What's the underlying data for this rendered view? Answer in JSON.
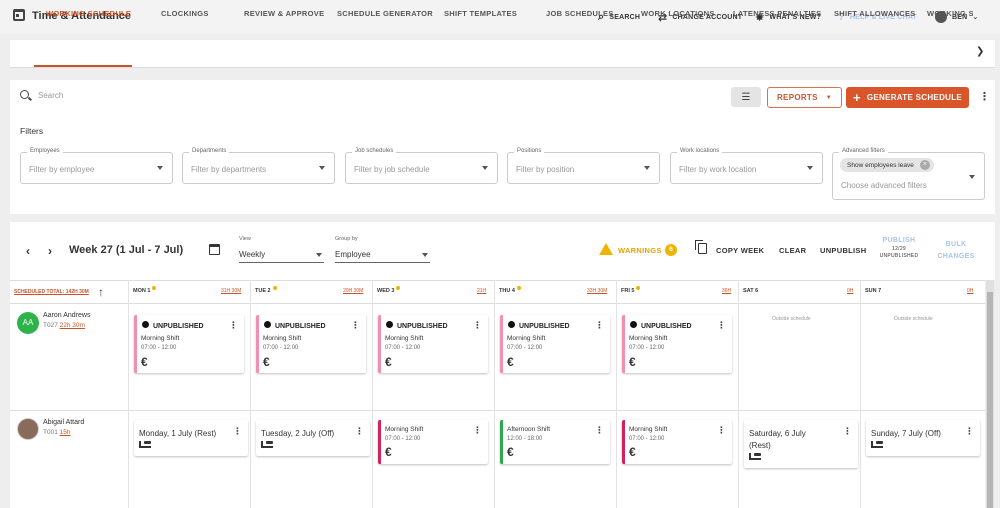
{
  "app": {
    "title": "Time & Attendance"
  },
  "topnav": {
    "search": "SEARCH",
    "change_account": "CHANGE ACCOUNT",
    "whats_new": "WHAT'S NEW?",
    "help": "HELP & LIVE CHAT",
    "user": "BEN"
  },
  "tabs": [
    {
      "label": "WORKING SCHEDULE",
      "active": true
    },
    {
      "label": "CLOCKINGS"
    },
    {
      "label": "REVIEW & APPROVE"
    },
    {
      "label": "SCHEDULE GENERATOR"
    },
    {
      "label": "SHIFT TEMPLATES"
    },
    {
      "label": "JOB SCHEDULES"
    },
    {
      "label": "WORK LOCATIONS"
    },
    {
      "label": "LATENESS PENALTIES"
    },
    {
      "label": "SHIFT ALLOWANCES"
    },
    {
      "label": "WORKING SC"
    }
  ],
  "toolbar": {
    "search_placeholder": "Search",
    "reports": "REPORTS",
    "generate": "GENERATE SCHEDULE"
  },
  "filters": {
    "title": "Filters",
    "employees": {
      "label": "Employees",
      "placeholder": "Filter by employee"
    },
    "departments": {
      "label": "Departments",
      "placeholder": "Filter by departments"
    },
    "job_schedules": {
      "label": "Job schedules",
      "placeholder": "Filter by job schedule"
    },
    "positions": {
      "label": "Positions",
      "placeholder": "Filter by position"
    },
    "work_locations": {
      "label": "Work locations",
      "placeholder": "Filter by work location"
    },
    "advanced": {
      "label": "Advanced filters",
      "chip": "Show employees leave",
      "placeholder": "Choose advanced filters"
    }
  },
  "week": {
    "title": "Week 27 (1 Jul - 7 Jul)",
    "view_label": "View",
    "view_value": "Weekly",
    "group_label": "Group by",
    "group_value": "Employee",
    "warnings": "WARNINGS",
    "warnings_count": "6",
    "copy_week": "COPY WEEK",
    "clear": "CLEAR",
    "unpublish": "UNPUBLISH",
    "publish": "PUBLISH",
    "publish_count": "12/29",
    "publish_sub": "UNPUBLISHED",
    "bulk_1": "BULK",
    "bulk_2": "CHANGES"
  },
  "grid": {
    "total": "SCHEDULED TOTAL: 142H 30M",
    "days": [
      {
        "name": "MON 1",
        "hours": "31H 30M",
        "warn": true
      },
      {
        "name": "TUE 2",
        "hours": "20H 30M",
        "warn": true
      },
      {
        "name": "WED 3",
        "hours": "21H",
        "warn": true
      },
      {
        "name": "THU 4",
        "hours": "33H 30M",
        "warn": true
      },
      {
        "name": "FRI 5",
        "hours": "36H",
        "warn": true
      },
      {
        "name": "SAT 6",
        "hours": "0H",
        "warn": false
      },
      {
        "name": "SUN 7",
        "hours": "0H",
        "warn": false
      }
    ],
    "outside_schedule": "Outside schedule",
    "shift_status": "UNPUBLISHED",
    "currency": "€",
    "employees": [
      {
        "initials": "AA",
        "name": "Aaron Andrews",
        "code": "T027",
        "hours": "22h 30m",
        "avatar_color": "#2db34a",
        "shift_name": "Morning Shift",
        "shift_time": "07:00 - 12:00"
      },
      {
        "name": "Abigail Attard",
        "code": "T001",
        "hours": "15h",
        "off": [
          "Monday, 1 July (Rest)",
          "Tuesday, 2 July (Off)",
          "Saturday, 6 July",
          "(Rest)",
          "Sunday, 7 July (Off)"
        ],
        "shifts": [
          {
            "name": "Morning Shift",
            "time": "07:00 - 12:00"
          },
          {
            "name": "Afternoon Shift",
            "time": "12:00 - 18:00"
          },
          {
            "name": "Morning Shift",
            "time": "07:00 - 12:00"
          }
        ]
      }
    ]
  }
}
